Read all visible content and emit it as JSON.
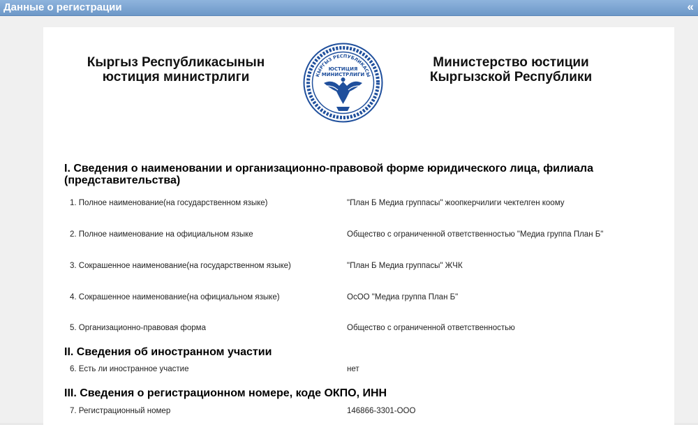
{
  "panel": {
    "title": "Данные о регистрации",
    "collapse": "«"
  },
  "header": {
    "left_line1": "Кыргыз Республикасынын",
    "left_line2": "юстиция министрлиги",
    "right_line1": "Министерство юстиции",
    "right_line2": "Кыргызской Республики",
    "seal_text_top": "КЫРГЫЗ РЕСПУБЛИКАСЫ",
    "seal_text_mid1": "ЮСТИЦИЯ",
    "seal_text_mid2": "МИНИСТРЛИГИ"
  },
  "sections": [
    {
      "title": "I. Сведения о наименовании и организационно-правовой форме юридического лица, филиала",
      "title_cont": "(представительства)"
    },
    {
      "title": "II. Сведения об иностранном участии"
    },
    {
      "title": "III. Сведения о регистрационном номере, коде ОКПО, ИНН"
    }
  ],
  "rows": [
    {
      "label": "1. Полное наименование(на государственном языке)",
      "value": "\"План Б Медиа группасы\" жоопкерчилиги чектелген коому"
    },
    {
      "label": "2. Полное наименование на официальном языке",
      "value": "Общество с ограниченной ответственностью \"Медиа группа План Б\""
    },
    {
      "label": "3. Сокрашенное наименование(на государственном языке)",
      "value": "\"План Б Медиа группасы\" ЖЧК"
    },
    {
      "label": "4. Сокрашенное наименование(на официальном языке)",
      "value": "ОсОО \"Медиа группа План Б\""
    },
    {
      "label": "5. Организационно-правовая форма",
      "value": "Общество с ограниченной ответственностью"
    },
    {
      "label": "6. Есть ли иностранное участие",
      "value": "нет"
    },
    {
      "label": "7. Регистрационный номер",
      "value": "146866-3301-ООО"
    }
  ],
  "colors": {
    "titlebar": "#7ea6d3",
    "seal_blue": "#1f4f9c"
  }
}
